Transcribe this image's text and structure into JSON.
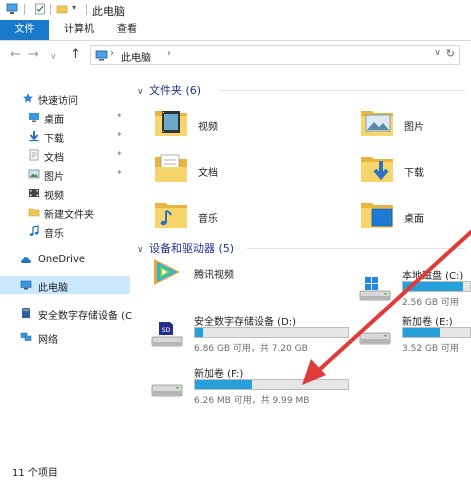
{
  "window": {
    "title": "此电脑"
  },
  "ribbon": {
    "tabs": [
      {
        "label": "文件"
      },
      {
        "label": "计算机"
      },
      {
        "label": "查看"
      }
    ]
  },
  "address": {
    "path": "此电脑"
  },
  "navigation": {
    "items": [
      {
        "label": "快速访问",
        "icon": "star-icon"
      },
      {
        "label": "桌面",
        "icon": "desktop-icon",
        "pinned": true
      },
      {
        "label": "下载",
        "icon": "download-icon",
        "pinned": true
      },
      {
        "label": "文档",
        "icon": "document-icon",
        "pinned": true
      },
      {
        "label": "图片",
        "icon": "picture-icon",
        "pinned": true
      },
      {
        "label": "视频",
        "icon": "video-icon"
      },
      {
        "label": "新建文件夹",
        "icon": "folder-icon"
      },
      {
        "label": "音乐",
        "icon": "music-icon"
      },
      {
        "label": "OneDrive",
        "icon": "cloud-icon"
      },
      {
        "label": "此电脑",
        "icon": "computer-icon",
        "selected": true
      },
      {
        "label": "安全数字存储设备 (C",
        "icon": "sd-card-icon"
      },
      {
        "label": "网络",
        "icon": "network-icon"
      }
    ]
  },
  "folders_group": {
    "heading": "文件夹 (6)",
    "items": [
      {
        "label": "视频",
        "icon": "video-folder-icon"
      },
      {
        "label": "图片",
        "icon": "picture-folder-icon"
      },
      {
        "label": "文档",
        "icon": "document-folder-icon"
      },
      {
        "label": "下载",
        "icon": "download-folder-icon"
      },
      {
        "label": "音乐",
        "icon": "music-folder-icon"
      },
      {
        "label": "桌面",
        "icon": "desktop-folder-icon"
      }
    ]
  },
  "devices_group": {
    "heading": "设备和驱动器 (5)",
    "items": [
      {
        "name": "腾讯视频",
        "icon": "tencent-video-icon"
      },
      {
        "name": "本地磁盘 (C:)",
        "size": "2.56 GB 可用",
        "used_fraction": 0.9,
        "icon": "windows-drive-icon"
      },
      {
        "name": "安全数字存储设备 (D:)",
        "size": "6.86 GB 可用，共 7.20 GB",
        "used_fraction": 0.05,
        "icon": "sd-card-drive-icon"
      },
      {
        "name": "新加卷 (E:)",
        "size": "3.52 GB 可用",
        "used_fraction": 0.55,
        "icon": "hard-drive-icon"
      },
      {
        "name": "新加卷 (F:)",
        "size": "6.26 MB 可用，共 9.99 MB",
        "used_fraction": 0.37,
        "icon": "hard-drive-icon"
      }
    ]
  },
  "status": {
    "text": "11 个项目"
  },
  "colors": {
    "accent": "#1979ca",
    "selection": "#cce8ff",
    "bar_fill": "#26a0da",
    "annotation_arrow": "#e03a3a"
  }
}
